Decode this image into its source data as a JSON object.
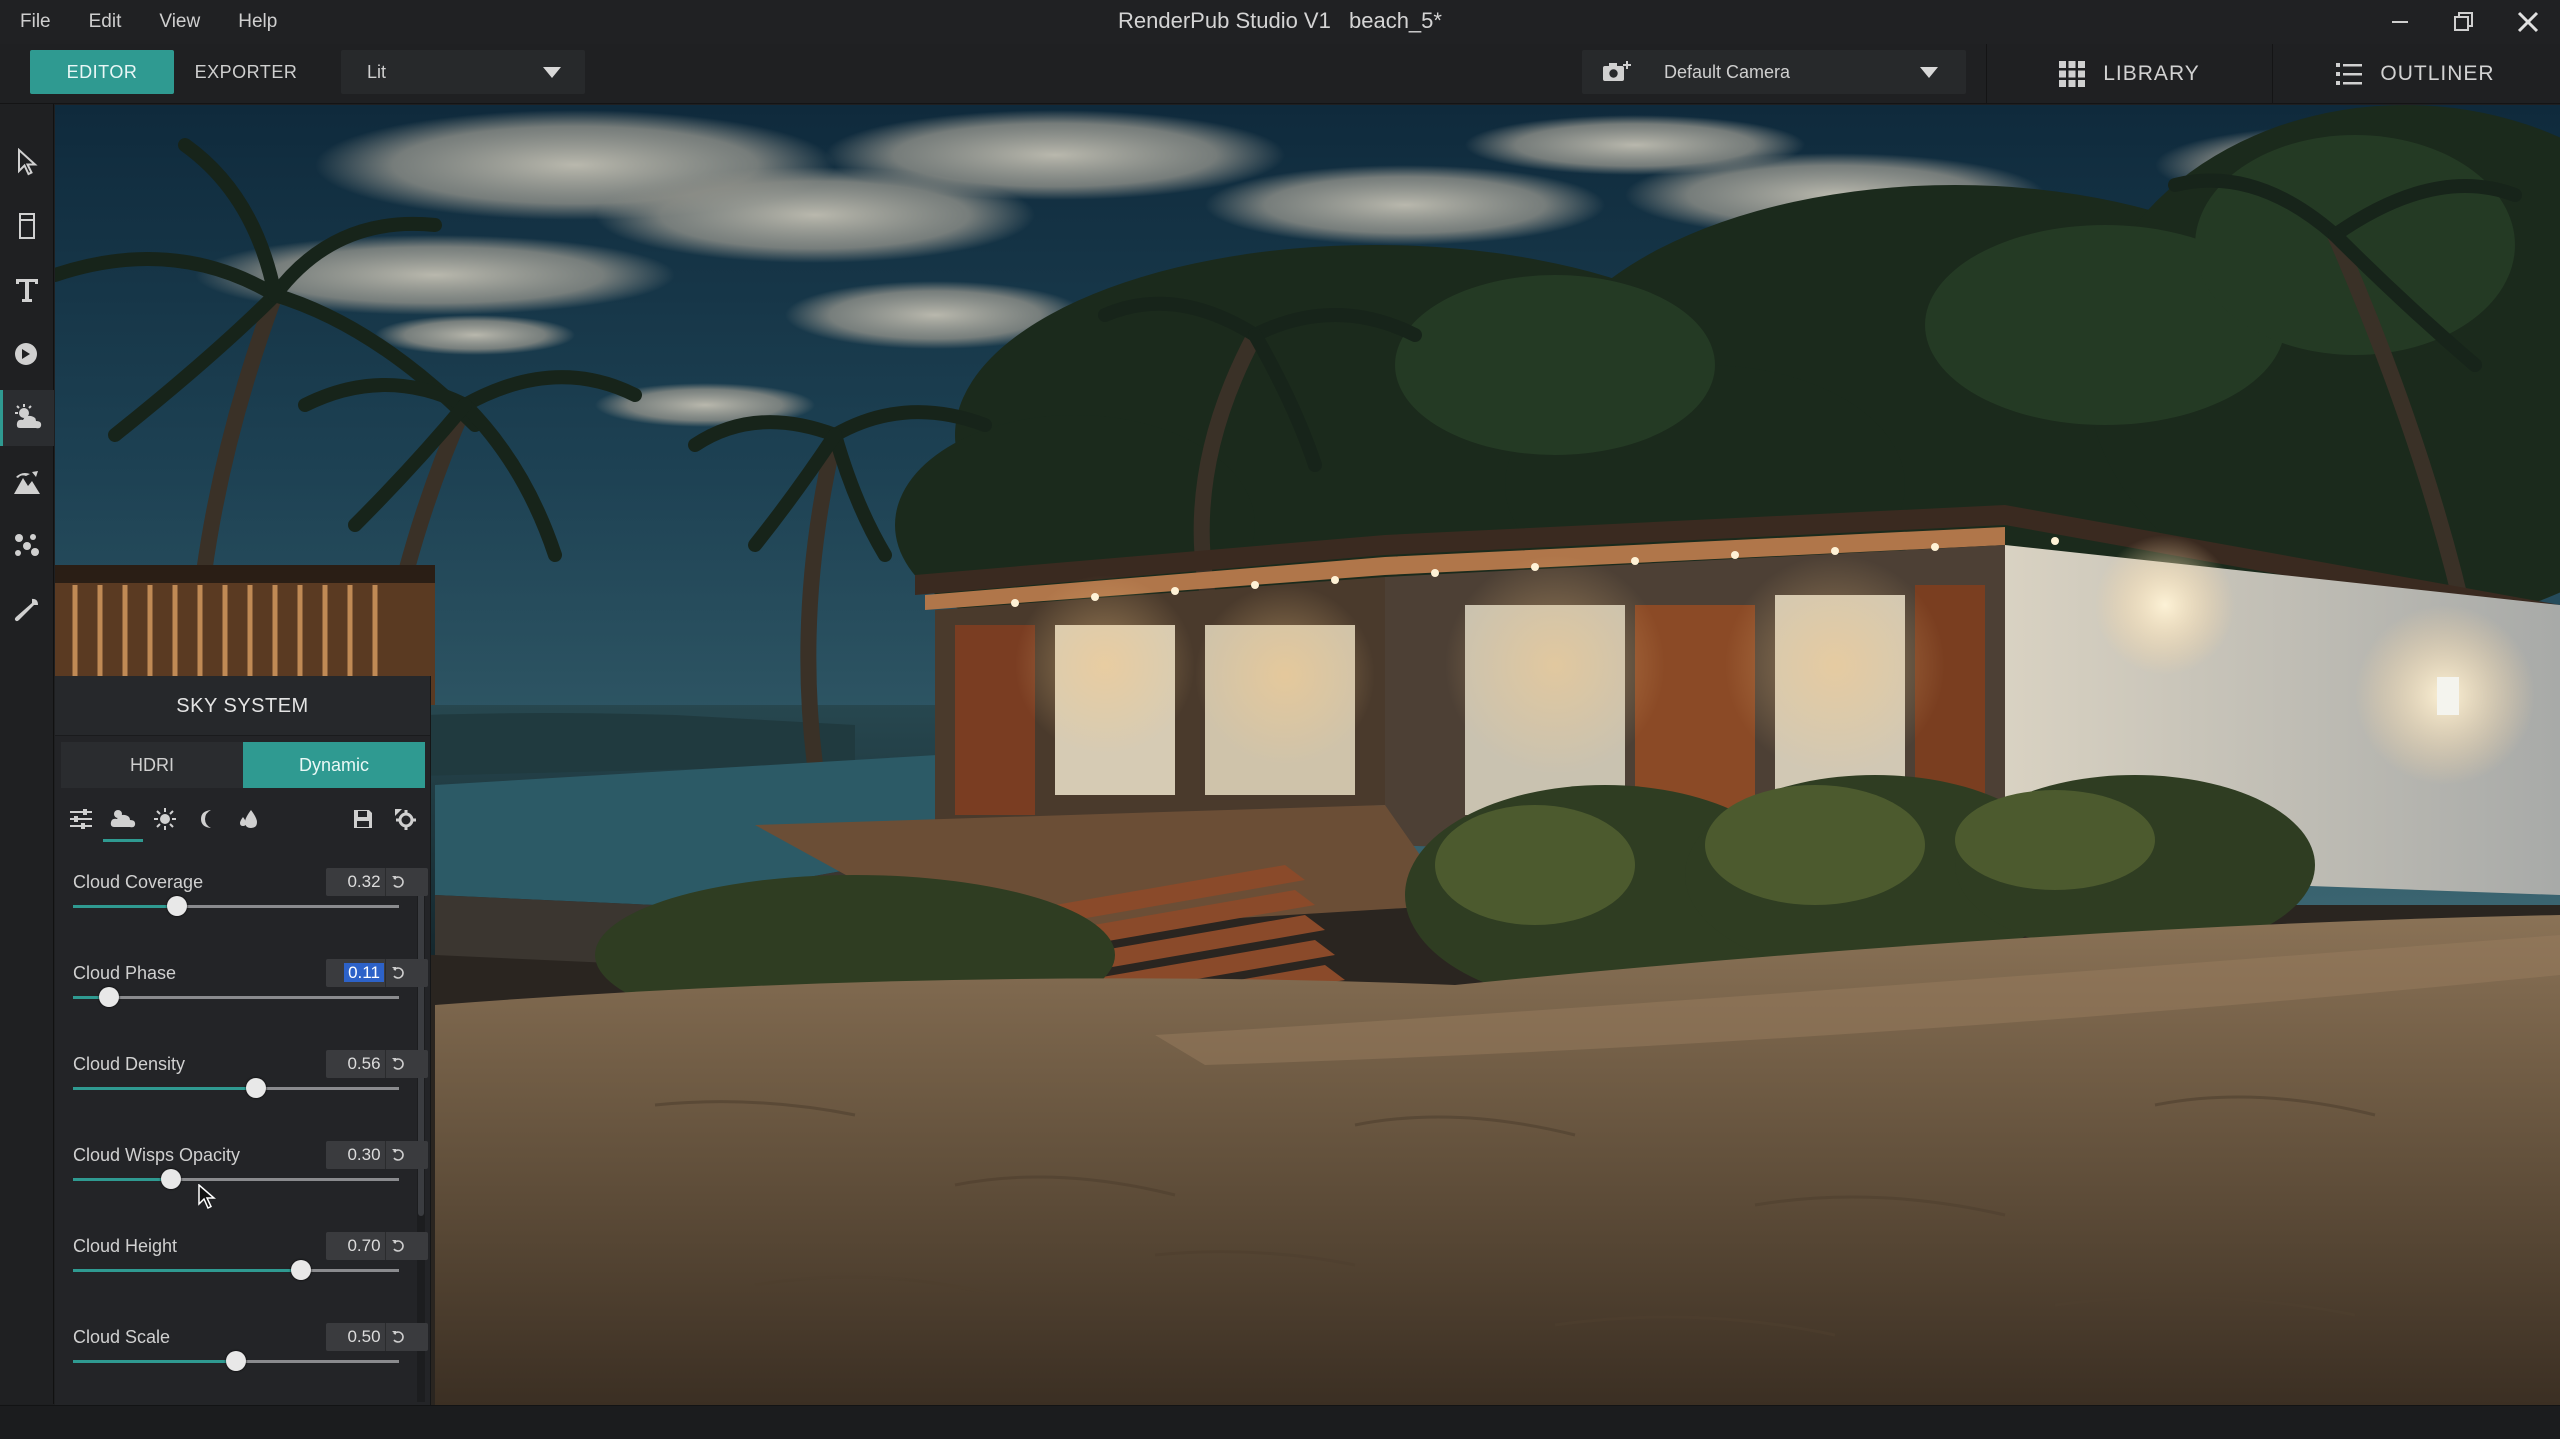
{
  "menu": [
    "File",
    "Edit",
    "View",
    "Help"
  ],
  "window": {
    "app_title": "RenderPub Studio V1",
    "file_name": "beach_5*"
  },
  "toolbar": {
    "editor_label": "EDITOR",
    "exporter_label": "EXPORTER",
    "view_mode": "Lit",
    "camera": "Default Camera",
    "library_label": "LIBRARY",
    "outliner_label": "OUTLINER"
  },
  "left_tools": [
    "select-tool",
    "object-tool",
    "text-tool",
    "material-tool",
    "sky-tool",
    "landscape-tool",
    "scatter-tool",
    "settings-tool"
  ],
  "sky_panel": {
    "title": "SKY SYSTEM",
    "mode_hdri": "HDRI",
    "mode_dynamic": "Dynamic",
    "params": [
      {
        "label": "Cloud Coverage",
        "value": "0.32",
        "fraction": 0.32
      },
      {
        "label": "Cloud Phase",
        "value": "0.11",
        "fraction": 0.11
      },
      {
        "label": "Cloud Density",
        "value": "0.56",
        "fraction": 0.56
      },
      {
        "label": "Cloud Wisps Opacity",
        "value": "0.30",
        "fraction": 0.3
      },
      {
        "label": "Cloud Height",
        "value": "0.70",
        "fraction": 0.7
      },
      {
        "label": "Cloud Scale",
        "value": "0.50",
        "fraction": 0.5
      }
    ]
  },
  "colors": {
    "accent": "#2f9a91",
    "panel_bg": "#232427",
    "bar_bg": "#1f2022",
    "selection": "#2d62c8"
  }
}
